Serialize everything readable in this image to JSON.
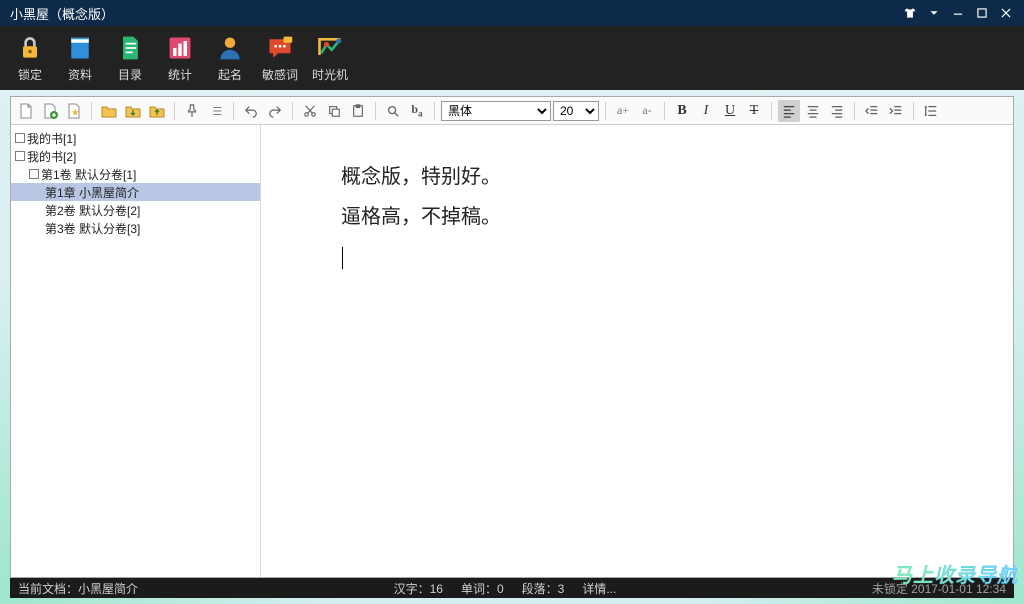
{
  "window": {
    "title": "小黑屋（概念版）"
  },
  "mainToolbar": [
    {
      "id": "lock",
      "label": "锁定"
    },
    {
      "id": "materials",
      "label": "资料"
    },
    {
      "id": "catalog",
      "label": "目录"
    },
    {
      "id": "stats",
      "label": "统计"
    },
    {
      "id": "naming",
      "label": "起名"
    },
    {
      "id": "sensitive",
      "label": "敏感词"
    },
    {
      "id": "timemachine",
      "label": "时光机"
    }
  ],
  "format": {
    "fontName": "黑体",
    "fontSize": "20",
    "increaseA": "a+",
    "decreaseA": "a-",
    "bold": "B",
    "italic": "I",
    "underline": "U",
    "strike": "T"
  },
  "tree": {
    "root1": "我的书[1]",
    "root2": "我的书[2]",
    "vol1": "第1卷 默认分卷[1]",
    "chap1": "第1章 小黑屋简介",
    "vol2": "第2卷 默认分卷[2]",
    "vol3": "第3卷 默认分卷[3]"
  },
  "editor": {
    "line1": "概念版，特别好。",
    "line2": "逼格高，不掉稿。"
  },
  "status": {
    "docLabel": "当前文档：",
    "docName": "小黑屋简介",
    "hanzi": "汉字：16",
    "words": "单词：0",
    "paras": "段落：3",
    "detail": "详情...",
    "saveState": "未锁定 2017-01-01 12:34"
  },
  "watermark": "马上收录导航"
}
